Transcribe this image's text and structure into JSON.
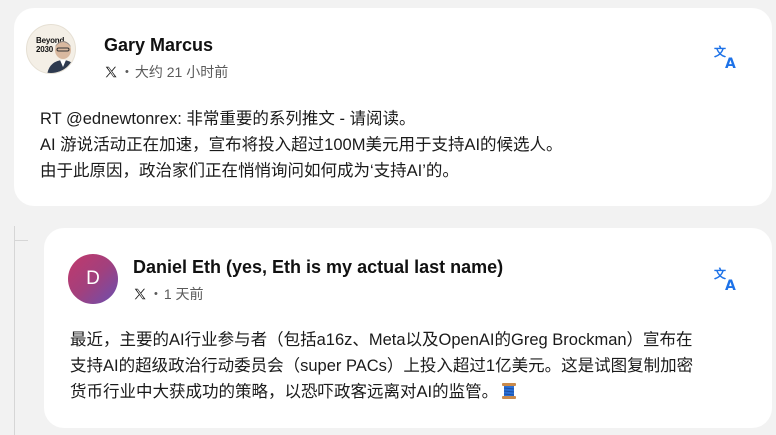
{
  "post": {
    "author_name": "Gary Marcus",
    "avatar_book_title": "Beyond 2030",
    "platform_icon": "x-logo-icon",
    "dot": "•",
    "timestamp": "大约 21 小时前",
    "lines": [
      "RT @ednewtonrex: 非常重要的系列推文 - 请阅读。",
      "AI 游说活动正在加速，宣布将投入超过100M美元用于支持AI的候选人。",
      "由于此原因，政治家们正在悄悄询问如何成为‘支持AI’的。"
    ]
  },
  "quoted_post": {
    "author_name": "Daniel Eth (yes, Eth is my actual last name)",
    "avatar_initial": "D",
    "platform_icon": "x-logo-icon",
    "dot": "•",
    "timestamp": "1 天前",
    "lines": [
      "最近，主要的AI行业参与者（包括a16z、Meta以及OpenAI的Greg Brockman）宣布在",
      "支持AI的超级政治行动委员会（super PACs）上投入超过1亿美元。这是试图复制加密",
      "货币行业中大获成功的策略，以恐吓政客远离对AI的监管。"
    ],
    "trailing_emoji": "spool-of-thread-icon"
  },
  "colors": {
    "background": "#f2f2f2",
    "card": "#ffffff",
    "translate_icon": "#1d72e8",
    "avatar_gradient_start": "#c2396b",
    "avatar_gradient_end": "#6a4fb0"
  }
}
